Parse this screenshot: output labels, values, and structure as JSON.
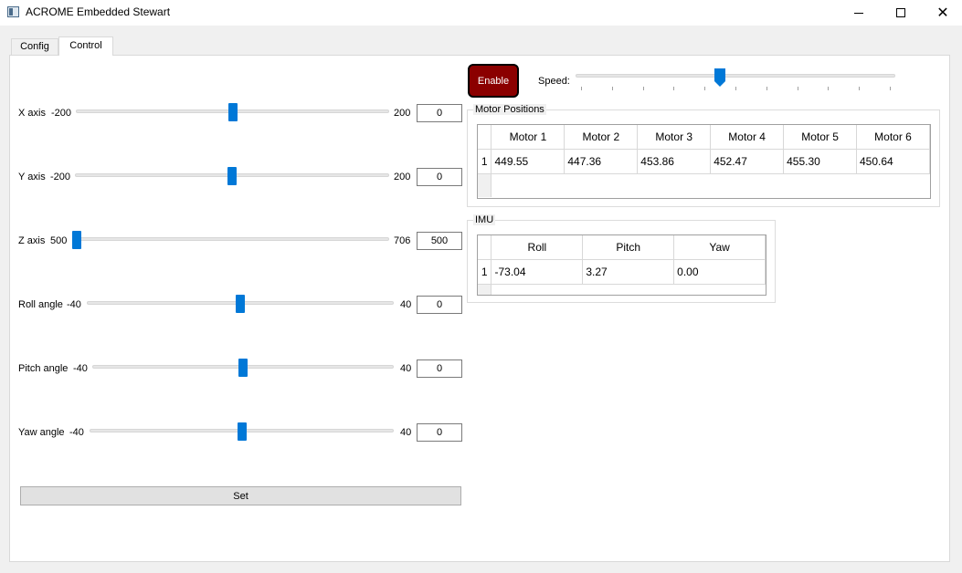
{
  "window": {
    "title": "ACROME Embedded Stewart"
  },
  "tabs": [
    {
      "label": "Config"
    },
    {
      "label": "Control"
    }
  ],
  "axes": [
    {
      "label": "X axis",
      "min": "-200",
      "max": "200",
      "value": "0",
      "position": 0.5
    },
    {
      "label": "Y axis",
      "min": "-200",
      "max": "200",
      "value": "0",
      "position": 0.5
    },
    {
      "label": "Z axis",
      "min": "500",
      "max": "706",
      "value": "500",
      "position": 0.0
    },
    {
      "label": "Roll angle",
      "min": "-40",
      "max": "40",
      "value": "0",
      "position": 0.5
    },
    {
      "label": "Pitch angle",
      "min": "-40",
      "max": "40",
      "value": "0",
      "position": 0.5
    },
    {
      "label": "Yaw angle",
      "min": "-40",
      "max": "40",
      "value": "0",
      "position": 0.5
    }
  ],
  "set_button": "Set",
  "enable_button": {
    "label": "Enable",
    "color": "#8b0000"
  },
  "speed": {
    "label": "Speed:",
    "position": 0.45
  },
  "motor_positions": {
    "title": "Motor Positions",
    "headers": [
      "Motor 1",
      "Motor 2",
      "Motor 3",
      "Motor 4",
      "Motor 5",
      "Motor 6"
    ],
    "row_number": "1",
    "values": [
      "449.55",
      "447.36",
      "453.86",
      "452.47",
      "455.30",
      "450.64"
    ]
  },
  "imu": {
    "title": "IMU",
    "headers": [
      "Roll",
      "Pitch",
      "Yaw"
    ],
    "row_number": "1",
    "values": [
      "-73.04",
      "3.27",
      "0.00"
    ]
  },
  "colors": {
    "accent": "#0078d7"
  }
}
